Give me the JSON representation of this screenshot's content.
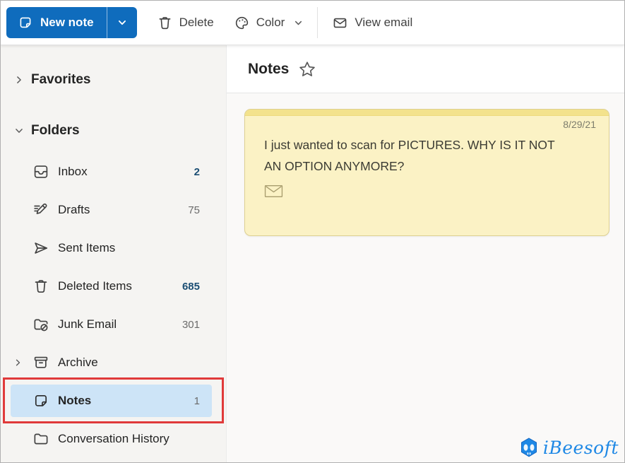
{
  "toolbar": {
    "new_note_label": "New note",
    "delete_label": "Delete",
    "color_label": "Color",
    "view_email_label": "View email"
  },
  "sidebar": {
    "favorites_label": "Favorites",
    "folders_label": "Folders",
    "folders": [
      {
        "label": "Inbox",
        "count": "2"
      },
      {
        "label": "Drafts",
        "count": "75"
      },
      {
        "label": "Sent Items",
        "count": ""
      },
      {
        "label": "Deleted Items",
        "count": "685"
      },
      {
        "label": "Junk Email",
        "count": "301"
      },
      {
        "label": "Archive",
        "count": ""
      },
      {
        "label": "Notes",
        "count": "1"
      },
      {
        "label": "Conversation History",
        "count": ""
      }
    ]
  },
  "main": {
    "title": "Notes"
  },
  "note": {
    "date": "8/29/21",
    "text": "I just wanted to scan for PICTURES. WHY IS IT NOT AN OPTION ANYMORE?"
  },
  "watermark": {
    "brand": "iBeesoft"
  },
  "colors": {
    "accent_blue": "#0f6cbd",
    "selected_folder_bg": "#cde4f7",
    "annotation_red": "#e03a3a",
    "note_bg": "#fbf2c5",
    "note_header_strip": "#f3e28c",
    "unread_count_blue": "#1b4e74",
    "brand_blue": "#1e88e5"
  }
}
